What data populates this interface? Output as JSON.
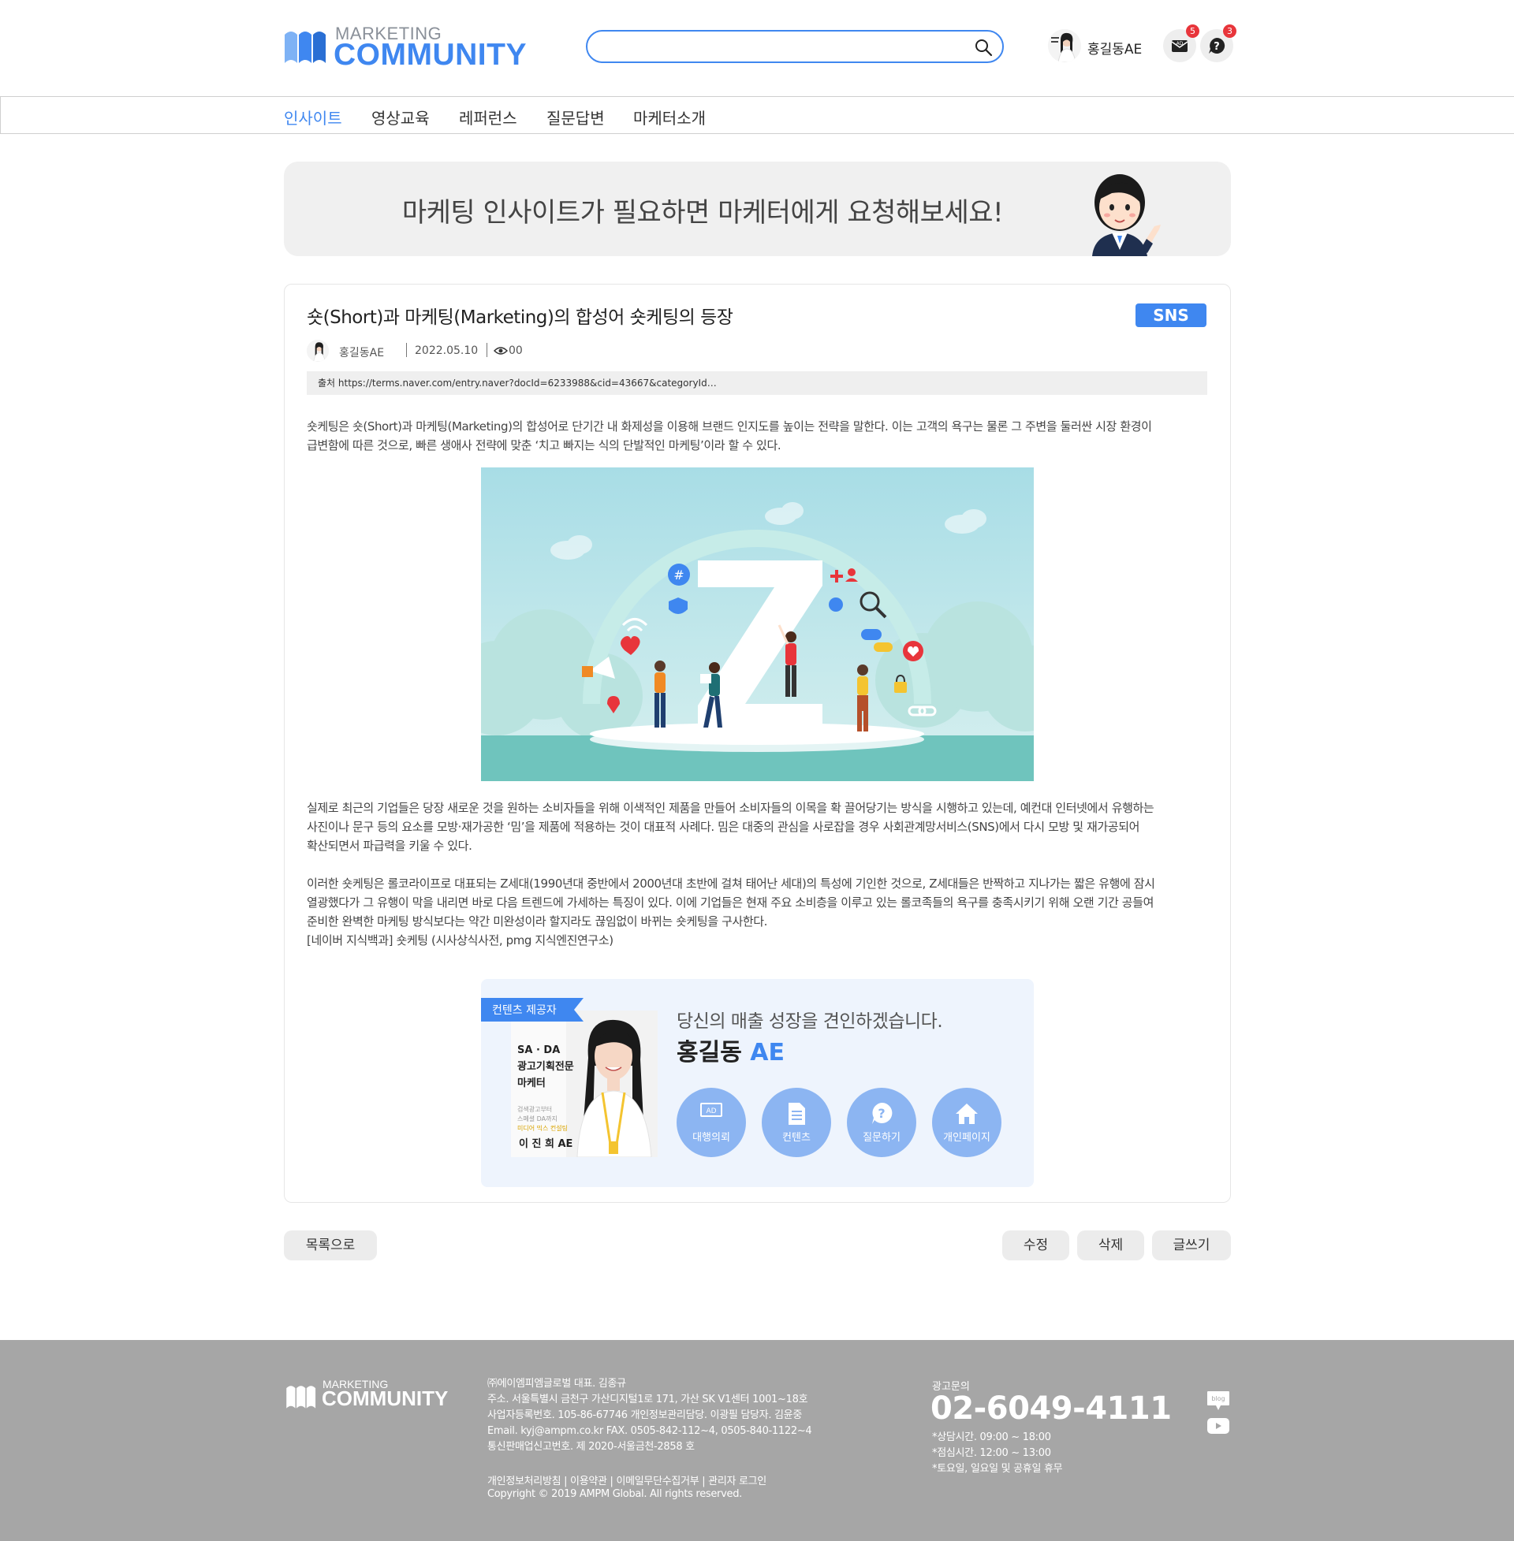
{
  "brand": {
    "logo_small": "MARKETING",
    "logo_big": "COMMUNITY"
  },
  "search": {
    "value": "",
    "placeholder": ""
  },
  "user": {
    "name": "홍길동AE",
    "ad_badge": "5",
    "question_badge": "3"
  },
  "nav": [
    {
      "label": "인사이트",
      "active": true
    },
    {
      "label": "영상교육",
      "active": false
    },
    {
      "label": "레퍼런스",
      "active": false
    },
    {
      "label": "질문답변",
      "active": false
    },
    {
      "label": "마케터소개",
      "active": false
    }
  ],
  "banner": {
    "text": "마케팅 인사이트가 필요하면 마케터에게 요청해보세요!"
  },
  "article": {
    "title": "숏(Short)과 마케팅(Marketing)의 합성어 숏케팅의 등장",
    "tag": "SNS",
    "author": "홍길동AE",
    "date": "2022.05.10",
    "views": "00",
    "source": "출처 https://terms.naver.com/entry.naver?docId=6233988&cid=43667&categoryId…",
    "para1": [
      "숏케팅은 숏(Short)과 마케팅(Marketing)의 합성어로 단기간 내 화제성을 이용해 브랜드 인지도를 높이는 전략을 말한다. 이는 고객의 욕구는 물론 그 주변을 둘러싼 시장 환경이",
      "급변함에 따른 것으로, 빠른 생애사 전략에 맞춘 ‘치고 빠지는 식의 단발적인 마케팅’이라 할 수 있다."
    ],
    "para2": [
      "실제로 최근의 기업들은 당장 새로운 것을 원하는 소비자들을 위해 이색적인 제품을 만들어 소비자들의 이목을 확 끌어당기는 방식을 시행하고 있는데, 예컨대 인터넷에서 유행하는",
      "사진이나 문구 등의 요소를 모방·재가공한 ‘밈’을 제품에 적용하는 것이 대표적 사례다. 밈은 대중의 관심을 사로잡을 경우 사회관계망서비스(SNS)에서 다시 모방 및 재가공되어",
      "확산되면서 파급력을 키울 수 있다."
    ],
    "para3": [
      "이러한 숏케팅은 롤코라이프로 대표되는 Z세대(1990년대 중반에서 2000년대 초반에 걸쳐 태어난 세대)의 특성에 기인한 것으로, Z세대들은 반짝하고 지나가는 짧은 유행에 잠시",
      "열광했다가 그 유행이 막을 내리면 바로 다음 트렌드에 가세하는 특징이 있다. 이에 기업들은 현재 주요 소비층을 이루고 있는 롤코족들의 욕구를 충족시키기 위해 오랜 기간 공들여",
      "준비한 완벽한 마케팅 방식보다는 약간 미완성이라 할지라도 끊임없이 바뀌는 숏케팅을 구사한다.",
      "[네이버 지식백과] 숏케팅 (시사상식사전, pmg 지식엔진연구소)"
    ]
  },
  "provider": {
    "ribbon": "컨텐츠 제공자",
    "card_lines": [
      "SA · DA",
      "광고기획전문",
      "마케터"
    ],
    "card_small": [
      "검색광고부터",
      "스페셜 DA까지"
    ],
    "card_highlight": "미디어 믹스 컨설팅",
    "card_name": "이 진 희 AE",
    "intro": "당신의 매출 성장을 견인하겠습니다.",
    "name": "홍길동",
    "name_suffix": "AE",
    "buttons": [
      {
        "label": "대행의뢰",
        "icon": "ad-icon",
        "icon_text": "AD"
      },
      {
        "label": "컨텐츠",
        "icon": "document-icon"
      },
      {
        "label": "질문하기",
        "icon": "question-icon"
      },
      {
        "label": "개인페이지",
        "icon": "home-icon"
      }
    ]
  },
  "actions": {
    "list": "목록으로",
    "edit": "수정",
    "delete": "삭제",
    "write": "글쓰기"
  },
  "footer": {
    "logo_small": "MARKETING",
    "logo_big": "COMMUNITY",
    "info": [
      "㈜에이엠피엠글로벌  대표. 김종규",
      "주소. 서울특별시 금천구 가산디지털1로 171, 가산 SK V1센터 1001~18호",
      "사업자등록번호. 105-86-67746  개인정보관리담당. 이광필  담당자. 김윤중",
      "Email. kyj@ampm.co.kr  FAX. 0505-842-112~4, 0505-840-1122~4",
      "통신판매업신고번호. 제 2020-서울금천-2858 호"
    ],
    "links": [
      "개인정보처리방침",
      "이용약관",
      "이메일무단수집거부",
      "관리자 로그인"
    ],
    "copyright": "Copyright © 2019 AMPM Global. All rights reserved.",
    "ad_label": "광고문의",
    "phone": "02-6049-4111",
    "hours": [
      "*상담시간. 09:00 ~ 18:00",
      "*점심시간. 12:00 ~ 13:00",
      "*토요일, 일요일 및 공휴일 휴무"
    ],
    "blog_label": "blog"
  },
  "colors": {
    "accent": "#3f87f0",
    "badge": "#e8353b",
    "footer_bg": "#a6a6a6",
    "provider_bg": "#eef4fd",
    "circle_btn": "#8cb5f2"
  }
}
